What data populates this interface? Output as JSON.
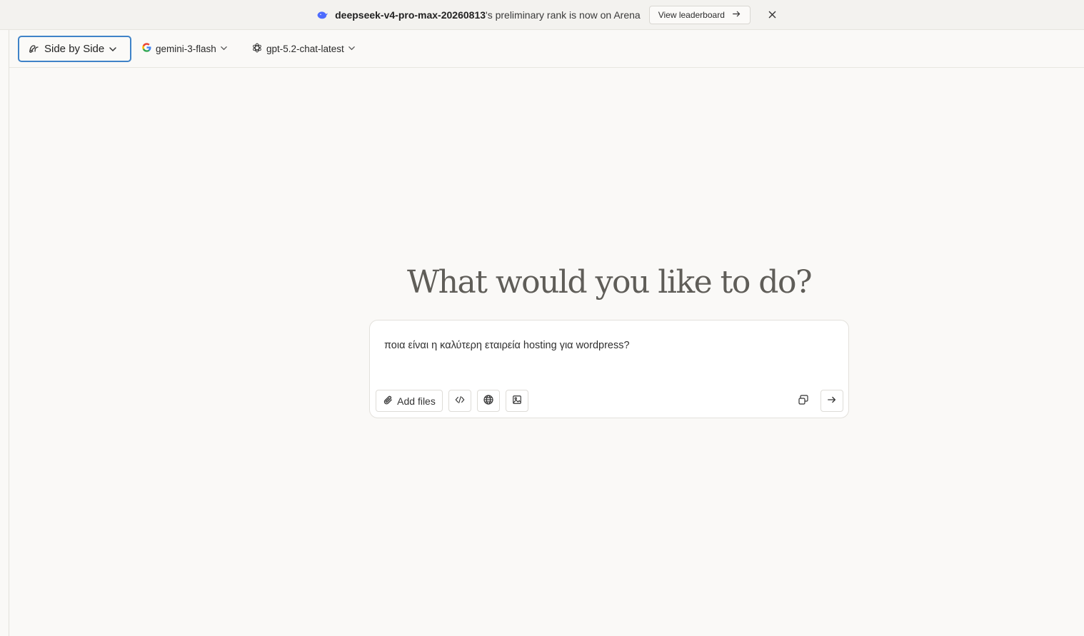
{
  "banner": {
    "model_name": "deepseek-v4-pro-max-20260813",
    "message_suffix": "'s preliminary rank is now on Arena",
    "cta_label": "View leaderboard"
  },
  "toolbar": {
    "mode_label": "Side by Side",
    "model_a": "gemini-3-flash",
    "model_b": "gpt-5.2-chat-latest"
  },
  "main": {
    "heading": "What would you like to do?",
    "prompt_value": "ποια είναι η καλύτερη εταιρεία hosting για wordpress?",
    "add_files_label": "Add files"
  },
  "icons": {
    "banner_logo": "whale-icon",
    "cta_arrow": "arrow-right-icon",
    "close": "close-icon",
    "mode": "side-by-side-icon",
    "model_a": "google-icon",
    "model_b": "openai-icon",
    "attach": "paperclip-icon",
    "code": "code-icon",
    "web": "globe-icon",
    "image": "image-icon",
    "stat": "compare-icon",
    "send": "arrow-right-icon"
  },
  "colors": {
    "background": "#faf9f7",
    "focus_border": "#3f83c8",
    "whale": "#4d6bfe"
  }
}
